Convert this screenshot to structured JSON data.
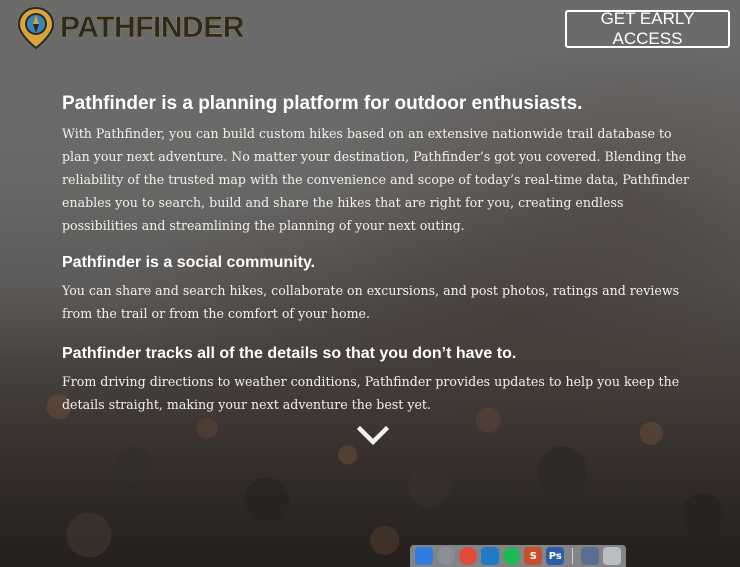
{
  "brand": {
    "name": "PATHFINDER",
    "accent": "#d9a53a"
  },
  "header": {
    "cta_label": "GET EARLY ACCESS"
  },
  "sections": [
    {
      "heading": "Pathfinder is a planning platform for outdoor enthusiasts.",
      "body": "With Pathfinder, you can build custom hikes based on an extensive nationwide trail database to plan your next adventure. No matter your destination, Pathfinder’s got you covered. Blending the reliability of the trusted map with the convenience and scope of today’s real-time data, Pathfinder enables you to search, build and share the hikes that are right for you, creating endless possibilities and streamlining the planning of your next outing."
    },
    {
      "heading": "Pathfinder is a social community.",
      "body": "You can share and search hikes, collaborate on excursions, and post photos, ratings and reviews from the trail or from the comfort of your home."
    },
    {
      "heading": "Pathfinder tracks all of the details so that you don’t have to.",
      "body": "From driving directions to weather conditions, Pathfinder provides updates to help you keep the details straight, making your next adventure the best yet."
    }
  ],
  "scroll_icon": "chevron-down-icon",
  "dock": {
    "items": [
      {
        "name": "finder-icon",
        "glyph": "",
        "color": "#2f7de1"
      },
      {
        "name": "launchpad-icon",
        "glyph": "",
        "color": "#8a8f96"
      },
      {
        "name": "chrome-icon",
        "glyph": "",
        "color": "#e04b3c"
      },
      {
        "name": "vscode-icon",
        "glyph": "",
        "color": "#1f7ac7"
      },
      {
        "name": "spotify-icon",
        "glyph": "",
        "color": "#1db954"
      },
      {
        "name": "sublime-icon",
        "glyph": "S",
        "color": "#c94f2c"
      },
      {
        "name": "photoshop-icon",
        "glyph": "Ps",
        "color": "#2a5fa8"
      },
      {
        "name": "preview-icon",
        "glyph": "",
        "color": "#5a6f8f"
      },
      {
        "name": "trash-icon",
        "glyph": "",
        "color": "#b9bec4"
      }
    ]
  }
}
